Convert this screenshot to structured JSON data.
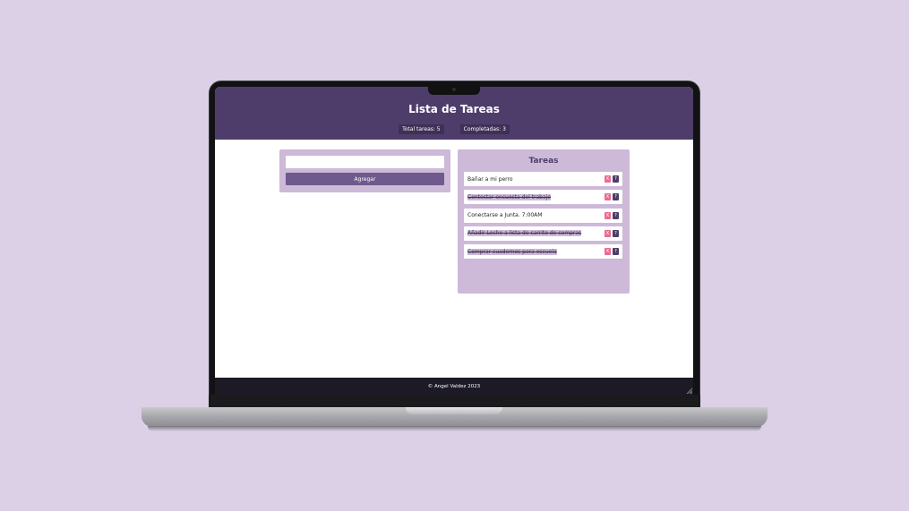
{
  "header": {
    "title": "Lista de Tareas",
    "total_label": "Total tareas: 5",
    "completed_label": "Completadas: 3"
  },
  "form": {
    "input_value": "",
    "input_placeholder": "",
    "add_button_label": "Agregar"
  },
  "tasks_panel": {
    "title": "Tareas",
    "items": [
      {
        "text": "Bañar a mi perro",
        "done": false,
        "delete_label": "X",
        "toggle_label": "?"
      },
      {
        "text": "Contestar encuesta del trabajo",
        "done": true,
        "delete_label": "X",
        "toggle_label": "?"
      },
      {
        "text": "Conectarse a Junta. 7:00AM",
        "done": false,
        "delete_label": "X",
        "toggle_label": "?"
      },
      {
        "text": "Añadir Leche a lista de carrito de compras",
        "done": true,
        "delete_label": "X",
        "toggle_label": "?"
      },
      {
        "text": "Comprar cuadernos para escuela",
        "done": true,
        "delete_label": "X",
        "toggle_label": "?"
      }
    ]
  },
  "footer": {
    "text": "© Angel Valdez 2023"
  },
  "colors": {
    "background": "#dcd0e6",
    "header": "#4e3d6a",
    "card": "#cdb9d8",
    "accent_button": "#6f5a8d",
    "delete": "#ec6a90",
    "footer": "#1d1a26"
  }
}
